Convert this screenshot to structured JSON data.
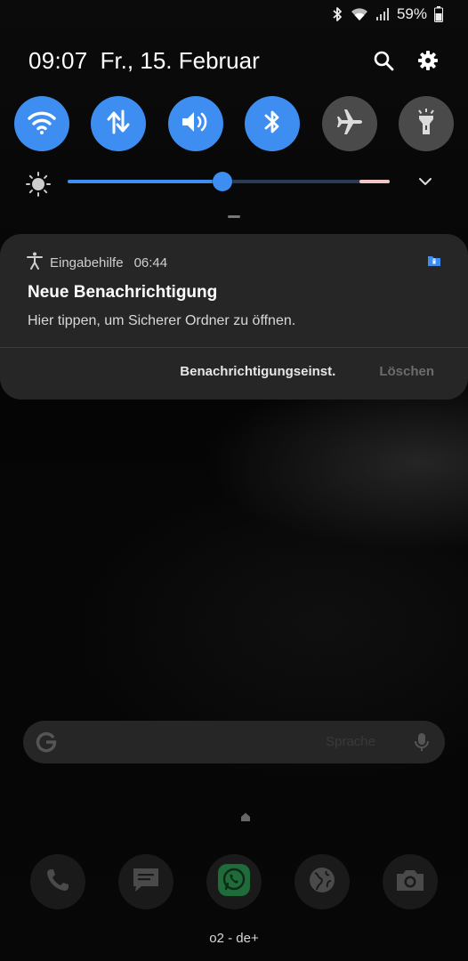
{
  "status_bar": {
    "battery_text": "59%",
    "icons": [
      "bluetooth-icon",
      "wifi-icon",
      "signal-icon",
      "battery-icon"
    ]
  },
  "header": {
    "time": "09:07",
    "date": "Fr., 15. Februar",
    "icons": [
      "search-icon",
      "settings-gear-icon"
    ]
  },
  "quick_settings": [
    {
      "name": "wifi",
      "icon": "wifi-icon",
      "state": "on"
    },
    {
      "name": "mobile-data",
      "icon": "data-arrows-icon",
      "state": "on"
    },
    {
      "name": "sound",
      "icon": "speaker-icon",
      "state": "on"
    },
    {
      "name": "bluetooth",
      "icon": "bluetooth-icon",
      "state": "on"
    },
    {
      "name": "airplane-mode",
      "icon": "airplane-icon",
      "state": "off"
    },
    {
      "name": "flashlight",
      "icon": "flashlight-icon",
      "state": "off"
    }
  ],
  "brightness": {
    "level": 0.48,
    "icon": "sun-icon"
  },
  "notification": {
    "app": "Eingabehilfe",
    "time": "06:44",
    "title": "Neue Benachrichtigung",
    "text": "Hier tippen, um Sicherer Ordner zu öffnen.",
    "actions": {
      "settings": "Benachrichtigungseinst.",
      "clear": "Löschen"
    }
  },
  "search_bar": {
    "hint": "Sprache"
  },
  "dock": [
    "phone-icon",
    "messages-icon",
    "whatsapp-icon",
    "internet-globe-icon",
    "camera-icon"
  ],
  "carrier": "o2 - de+",
  "colors": {
    "accent": "#3d8ef0",
    "toggle_off": "#4a4a4a",
    "card": "#262626",
    "whatsapp": "#25d366"
  }
}
